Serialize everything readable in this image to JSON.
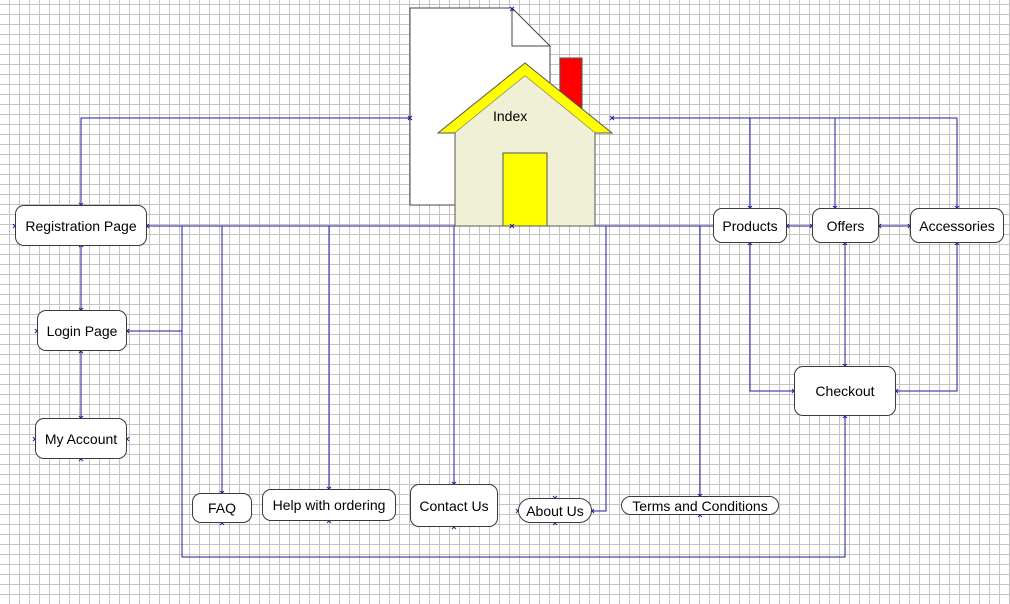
{
  "colors": {
    "connector": "#1e1e9e",
    "grid": "#c4c4c4",
    "house_roof": "#ffff00",
    "house_body": "#eff0d6",
    "house_door": "#ffff00",
    "chimney": "#ff0000",
    "page_icon": "#ffffff"
  },
  "index": {
    "label": "Index"
  },
  "nodes": {
    "registration": "Registration Page",
    "login": "Login Page",
    "my_account": "My Account",
    "products": "Products",
    "offers": "Offers",
    "accessories": "Accessories",
    "checkout": "Checkout",
    "faq": "FAQ",
    "help": "Help with ordering",
    "contact": "Contact Us",
    "about": "About Us",
    "terms": "Terms and Conditions"
  }
}
